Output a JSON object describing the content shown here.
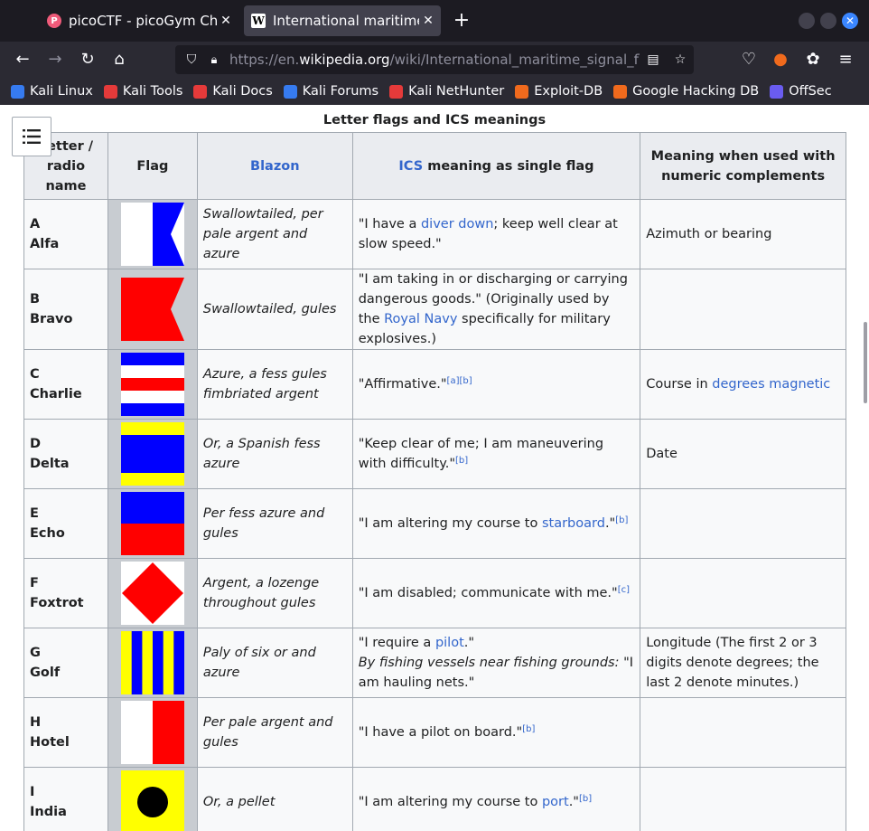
{
  "tabs": [
    {
      "favicon": "P",
      "title": "picoCTF - picoGym Challe",
      "active": false
    },
    {
      "favicon": "W",
      "title": "International maritime sig",
      "active": true
    }
  ],
  "urlbar": {
    "scheme": "https://en.",
    "host": "wikipedia.org",
    "path": "/wiki/International_maritime_signal_flags"
  },
  "bookmarks": [
    {
      "label": "Kali Linux",
      "color": "#367bf0"
    },
    {
      "label": "Kali Tools",
      "color": "#e53a3a"
    },
    {
      "label": "Kali Docs",
      "color": "#e53a3a"
    },
    {
      "label": "Kali Forums",
      "color": "#367bf0"
    },
    {
      "label": "Kali NetHunter",
      "color": "#e53a3a"
    },
    {
      "label": "Exploit-DB",
      "color": "#f06a1d"
    },
    {
      "label": "Google Hacking DB",
      "color": "#f06a1d"
    },
    {
      "label": "OffSec",
      "color": "#6a5cf0"
    }
  ],
  "table": {
    "caption": "Letter flags and ICS meanings",
    "headers": {
      "letter": "Letter / radio name",
      "flag": "Flag",
      "blazon": "Blazon",
      "ics_link": "ICS",
      "ics_rest": " meaning as single flag",
      "numeric": "Meaning when used with numeric complements"
    },
    "rows": [
      {
        "letter": "A",
        "name": "Alfa",
        "blazon": "Swallowtailed, per pale argent and azure",
        "meaning": [
          {
            "t": "\"I have a "
          },
          {
            "t": "diver down",
            "link": true
          },
          {
            "t": "; keep well clear at slow speed.\""
          }
        ],
        "numeric": [
          {
            "t": "Azimuth or bearing"
          }
        ]
      },
      {
        "letter": "B",
        "name": "Bravo",
        "blazon": "Swallowtailed, gules",
        "meaning": [
          {
            "t": "\"I am taking in or discharging or carrying dangerous goods.\" (Originally used by the "
          },
          {
            "t": "Royal Navy",
            "link": true
          },
          {
            "t": " specifically for military explosives.)"
          }
        ],
        "numeric": []
      },
      {
        "letter": "C",
        "name": "Charlie",
        "blazon": "Azure, a fess gules fimbriated argent",
        "meaning": [
          {
            "t": "\"Affirmative.\""
          },
          {
            "t": "[a][b]",
            "sup": true
          }
        ],
        "numeric": [
          {
            "t": "Course in "
          },
          {
            "t": "degrees magnetic",
            "link": true
          }
        ]
      },
      {
        "letter": "D",
        "name": "Delta",
        "blazon": "Or, a Spanish fess azure",
        "meaning": [
          {
            "t": "\"Keep clear of me; I am maneuvering with difficulty.\""
          },
          {
            "t": "[b]",
            "sup": true
          }
        ],
        "numeric": [
          {
            "t": "Date"
          }
        ]
      },
      {
        "letter": "E",
        "name": "Echo",
        "blazon": "Per fess azure and gules",
        "meaning": [
          {
            "t": "\"I am altering my course to "
          },
          {
            "t": "starboard",
            "link": true
          },
          {
            "t": ".\""
          },
          {
            "t": "[b]",
            "sup": true
          }
        ],
        "numeric": []
      },
      {
        "letter": "F",
        "name": "Foxtrot",
        "blazon": "Argent, a lozenge throughout gules",
        "meaning": [
          {
            "t": "\"I am disabled; communicate with me.\""
          },
          {
            "t": "[c]",
            "sup": true
          }
        ],
        "numeric": []
      },
      {
        "letter": "G",
        "name": "Golf",
        "blazon": "Paly of six or and azure",
        "meaning": [
          {
            "t": "\"I require a "
          },
          {
            "t": "pilot",
            "link": true
          },
          {
            "t": ".\""
          },
          {
            "t": "By fishing vessels near fishing grounds:",
            "italic": true,
            "br": true
          },
          {
            "t": " \"I am hauling nets.\""
          }
        ],
        "numeric": [
          {
            "t": "Longitude (The first 2 or 3 digits denote degrees; the last 2 denote minutes.)"
          }
        ]
      },
      {
        "letter": "H",
        "name": "Hotel",
        "blazon": "Per pale argent and gules",
        "meaning": [
          {
            "t": "\"I have a pilot on board.\""
          },
          {
            "t": "[b]",
            "sup": true
          }
        ],
        "numeric": []
      },
      {
        "letter": "I",
        "name": "India",
        "blazon": "Or, a pellet",
        "meaning": [
          {
            "t": "\"I am altering my course to "
          },
          {
            "t": "port",
            "link": true
          },
          {
            "t": ".\""
          },
          {
            "t": "[b]",
            "sup": true
          }
        ],
        "numeric": []
      }
    ]
  }
}
